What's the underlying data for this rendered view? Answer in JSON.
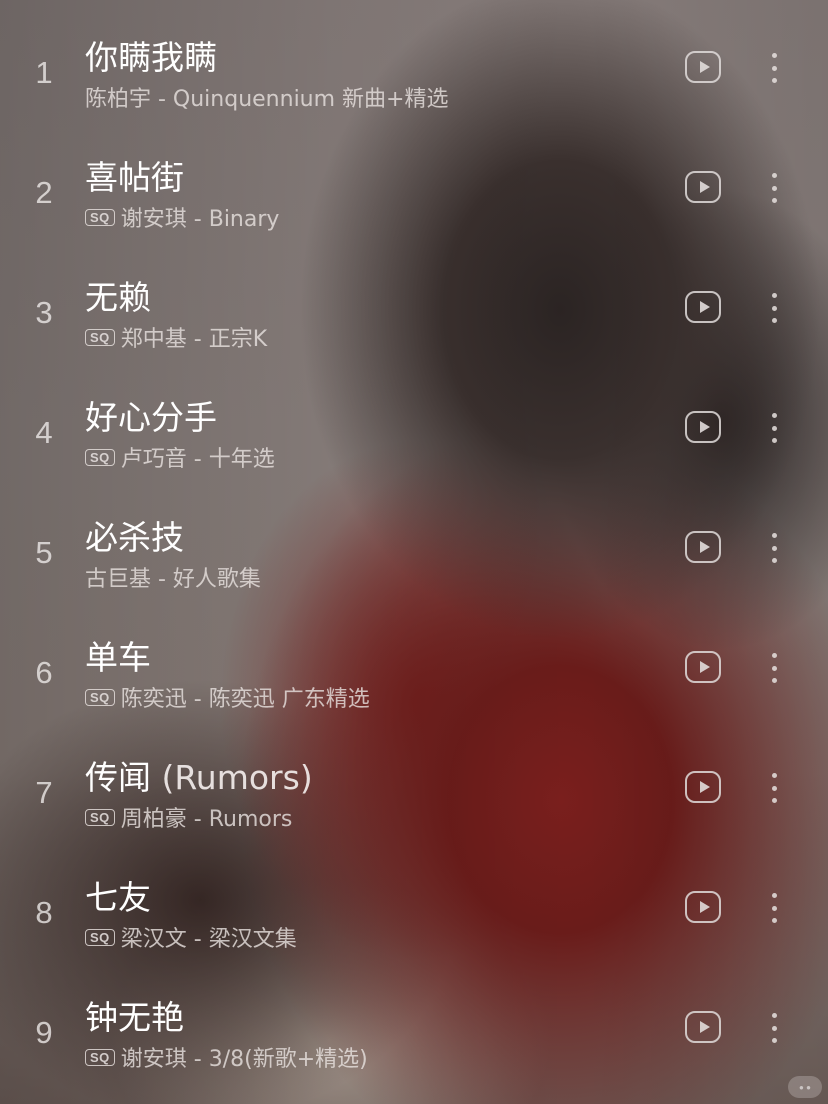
{
  "songs": [
    {
      "index": "1",
      "title": "你瞒我瞒",
      "title_extra": "",
      "sq": false,
      "subtitle": "陈柏宇 - Quinquennium 新曲+精选"
    },
    {
      "index": "2",
      "title": "喜帖街",
      "title_extra": "",
      "sq": true,
      "subtitle": "谢安琪 - Binary"
    },
    {
      "index": "3",
      "title": "无赖",
      "title_extra": "",
      "sq": true,
      "subtitle": "郑中基 - 正宗K"
    },
    {
      "index": "4",
      "title": "好心分手",
      "title_extra": "",
      "sq": true,
      "subtitle": "卢巧音 - 十年选"
    },
    {
      "index": "5",
      "title": "必杀技",
      "title_extra": "",
      "sq": false,
      "subtitle": "古巨基 - 好人歌集"
    },
    {
      "index": "6",
      "title": "单车",
      "title_extra": "",
      "sq": true,
      "subtitle": "陈奕迅 - 陈奕迅 广东精选"
    },
    {
      "index": "7",
      "title": "传闻",
      "title_extra": " (Rumors)",
      "sq": true,
      "subtitle": "周柏豪 - Rumors"
    },
    {
      "index": "8",
      "title": "七友",
      "title_extra": "",
      "sq": true,
      "subtitle": "梁汉文 - 梁汉文集"
    },
    {
      "index": "9",
      "title": "钟无艳",
      "title_extra": "",
      "sq": true,
      "subtitle": "谢安琪 - 3/8(新歌+精选)"
    }
  ],
  "badges": {
    "sq_label": "SQ"
  },
  "icons": {
    "play": "play-icon",
    "more": "more-vertical-icon"
  },
  "colors": {
    "title": "#ffffff",
    "subtitle": "#e8e2e0",
    "accent_red": "#7a1f1d"
  }
}
